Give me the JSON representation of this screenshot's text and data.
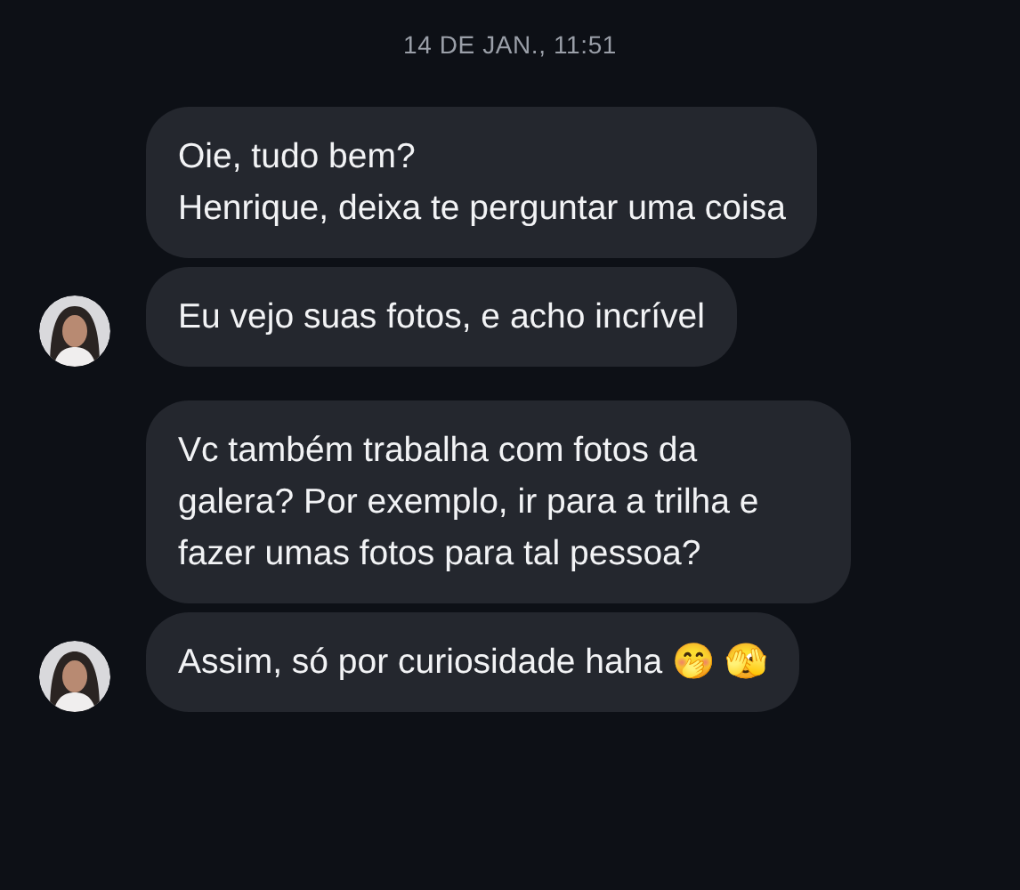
{
  "timestamp": "14 DE JAN., 11:51",
  "groups": [
    {
      "messages": [
        "Oie, tudo bem?\nHenrique, deixa te perguntar uma coisa",
        "Eu vejo suas fotos, e acho incrível"
      ]
    },
    {
      "messages": [
        "Vc também trabalha com fotos da galera? Por exemplo, ir para a trilha e fazer umas fotos para tal pessoa?",
        "Assim, só por curiosidade haha 🤭 🫣"
      ]
    }
  ]
}
